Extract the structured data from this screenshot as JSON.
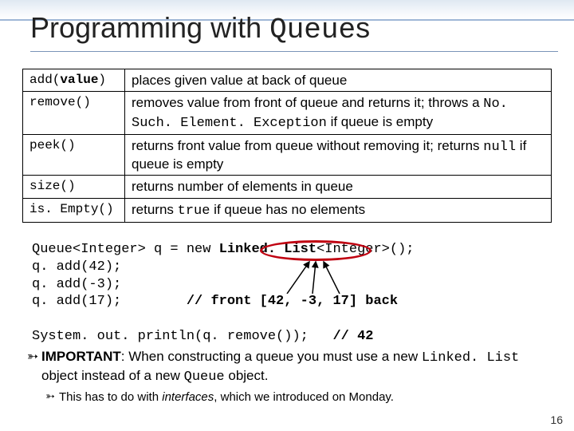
{
  "title": {
    "prefix": "Programming with ",
    "mono": "Queue",
    "suffix": "s"
  },
  "methods": [
    {
      "sig_pre": "add(",
      "sig_arg": "value",
      "sig_post": ")",
      "desc_pre": "places given value at back of queue",
      "desc_mono1": "",
      "desc_mid": "",
      "desc_mono2": "",
      "desc_post": ""
    },
    {
      "sig_pre": "remove()",
      "sig_arg": "",
      "sig_post": "",
      "desc_pre": "removes value from front of queue and returns it; throws a ",
      "desc_mono1": "No. Such. Element. Exception",
      "desc_mid": " if queue is empty",
      "desc_mono2": "",
      "desc_post": ""
    },
    {
      "sig_pre": "peek()",
      "sig_arg": "",
      "sig_post": "",
      "desc_pre": "returns front value from queue without removing it; returns ",
      "desc_mono1": "null",
      "desc_mid": " if queue is empty",
      "desc_mono2": "",
      "desc_post": ""
    },
    {
      "sig_pre": "size()",
      "sig_arg": "",
      "sig_post": "",
      "desc_pre": "returns number of elements in queue",
      "desc_mono1": "",
      "desc_mid": "",
      "desc_mono2": "",
      "desc_post": ""
    },
    {
      "sig_pre": "is. Empty()",
      "sig_arg": "",
      "sig_post": "",
      "desc_pre": "returns ",
      "desc_mono1": "true",
      "desc_mid": " if queue has no elements",
      "desc_mono2": "",
      "desc_post": ""
    }
  ],
  "code": {
    "l1a": "Queue<Integer> q = new ",
    "l1b": "Linked. List",
    "l1c": "<Integer>();",
    "l2": "q. add(42);",
    "l3": "q. add(-3);",
    "l4a": "q. add(17);        ",
    "l4b": "// front [42, -3, 17] back",
    "blank": "",
    "l5a": "System. out. println(q. remove());   ",
    "l5b": "// 42"
  },
  "note": {
    "lead": "IMPORTANT",
    "t1": ": When constructing a queue you must use a new ",
    "m1": "Linked. List",
    "t2": " object instead of a new ",
    "m2": "Queue",
    "t3": " object.",
    "sub_a": "This has to do with ",
    "sub_i": "interfaces",
    "sub_b": ", which we introduced on Monday."
  },
  "page": "16"
}
